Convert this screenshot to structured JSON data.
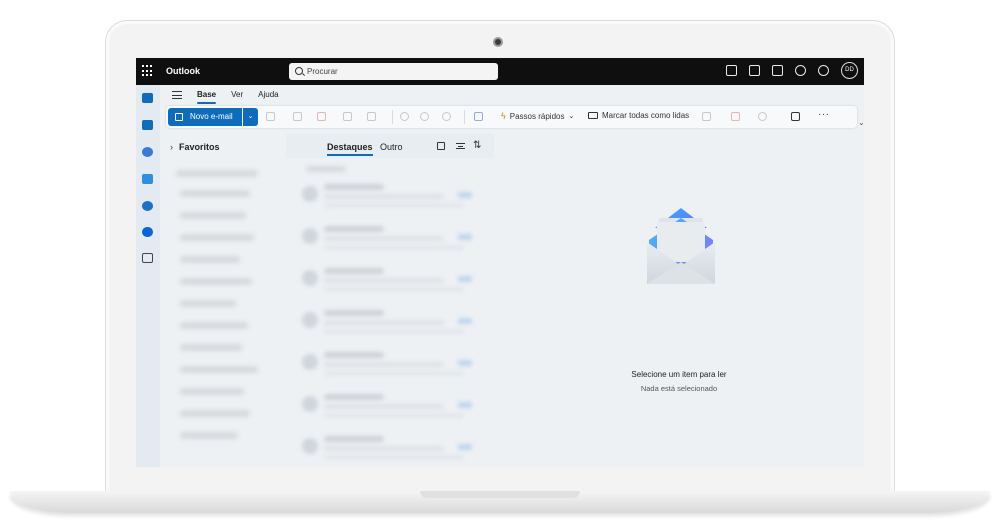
{
  "app": {
    "title": "Outlook",
    "avatar_initials": "DD"
  },
  "search": {
    "placeholder": "Procurar"
  },
  "menu": {
    "tabs": [
      "Base",
      "Ver",
      "Ajuda"
    ],
    "active": "Base"
  },
  "ribbon": {
    "new_mail_label": "Novo e-mail",
    "quick_steps_label": "Passos rápidos",
    "mark_all_read_label": "Marcar todas como lidas",
    "more_label": "···"
  },
  "folders": {
    "favorites_label": "Favoritos"
  },
  "mail_list": {
    "tabs": [
      "Destaques",
      "Outro"
    ],
    "active": "Destaques",
    "group_label": "Hoje"
  },
  "reading_pane": {
    "empty_title": "Selecione um item para ler",
    "empty_subtitle": "Nada está selecionado"
  },
  "colors": {
    "accent": "#0f6cbd",
    "topbar": "#0f0f0f"
  },
  "icons": [
    "apps-grid-icon",
    "search-icon",
    "chat-icon",
    "onenote-icon",
    "tasks-icon",
    "bell-icon",
    "gear-icon",
    "mail-icon",
    "calendar-icon",
    "people-icon",
    "todo-icon",
    "org-icon",
    "onedrive-icon",
    "apps-icon"
  ]
}
